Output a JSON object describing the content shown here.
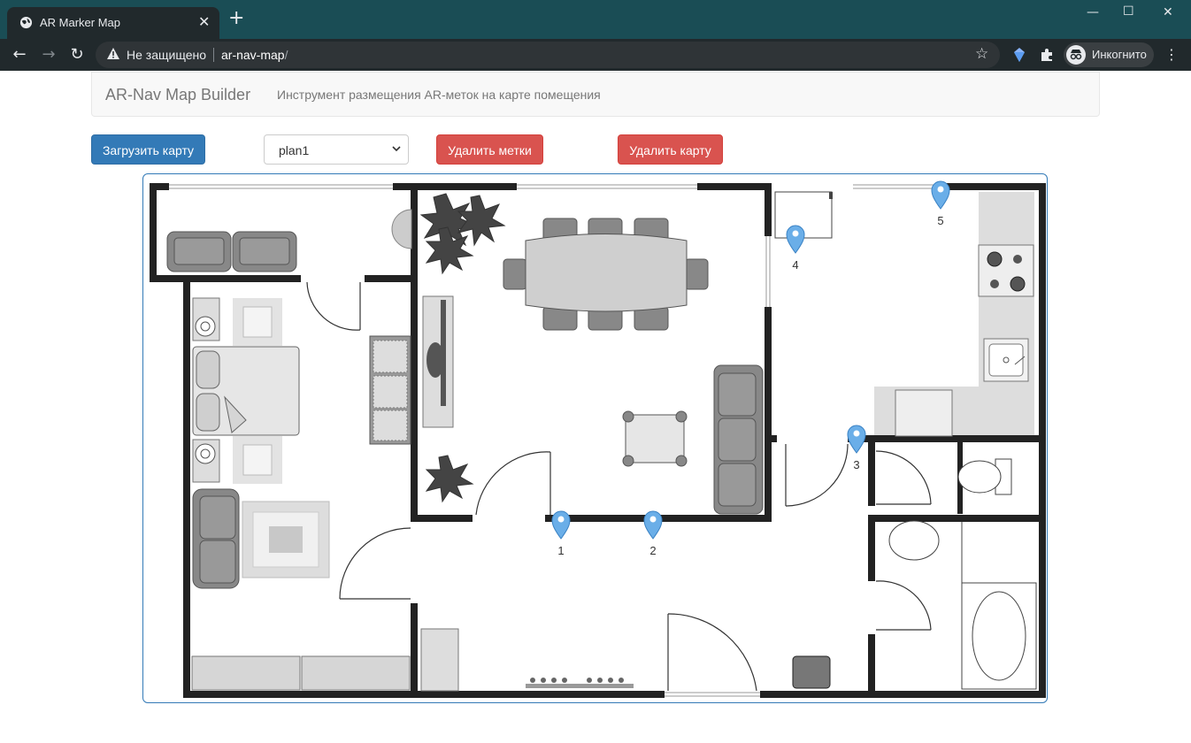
{
  "browser": {
    "tab_title": "AR Marker Map",
    "tab_close": "✕",
    "new_tab": "+",
    "security_label": "Не защищено",
    "url_host": "ar-nav-map",
    "url_path": "/",
    "profile_label": "Инкогнито",
    "accent_color": "#1a4d55"
  },
  "navbar": {
    "brand": "AR-Nav Map Builder",
    "subtitle": "Инструмент размещения AR-меток на карте помещения"
  },
  "controls": {
    "upload_label": "Загрузить карту",
    "plan_select_value": "plan1",
    "delete_markers_label": "Удалить метки",
    "delete_map_label": "Удалить карту"
  },
  "markers": [
    {
      "label": "1"
    },
    {
      "label": "2"
    },
    {
      "label": "3"
    },
    {
      "label": "4"
    },
    {
      "label": "5"
    }
  ],
  "colors": {
    "primary": "#337ab7",
    "danger": "#d9534f",
    "marker": "#6aaee8",
    "wall": "#222222"
  }
}
